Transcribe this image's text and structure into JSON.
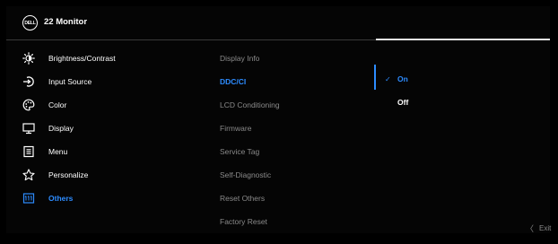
{
  "header": {
    "logo_text": "DELL",
    "title": "22 Monitor"
  },
  "menu": {
    "items": [
      {
        "label": "Brightness/Contrast",
        "icon": "brightness-icon"
      },
      {
        "label": "Input Source",
        "icon": "input-source-icon"
      },
      {
        "label": "Color",
        "icon": "color-palette-icon"
      },
      {
        "label": "Display",
        "icon": "display-icon"
      },
      {
        "label": "Menu",
        "icon": "menu-icon"
      },
      {
        "label": "Personalize",
        "icon": "star-icon"
      },
      {
        "label": "Others",
        "icon": "others-icon",
        "active": true
      }
    ]
  },
  "submenu": {
    "items": [
      {
        "label": "Display Info"
      },
      {
        "label": "DDC/CI",
        "active": true
      },
      {
        "label": "LCD Conditioning"
      },
      {
        "label": "Firmware"
      },
      {
        "label": "Service Tag"
      },
      {
        "label": "Self-Diagnostic"
      },
      {
        "label": "Reset Others"
      },
      {
        "label": "Factory Reset"
      }
    ]
  },
  "options": {
    "items": [
      {
        "label": "On",
        "selected": true,
        "check": "✓"
      },
      {
        "label": "Off",
        "selected": false,
        "check": ""
      }
    ]
  },
  "footer": {
    "exit_label": "Exit",
    "chevron": "〈"
  },
  "colors": {
    "accent": "#2d8cff",
    "background": "#050505",
    "text": "#ffffff",
    "muted": "#8a8a8a"
  }
}
